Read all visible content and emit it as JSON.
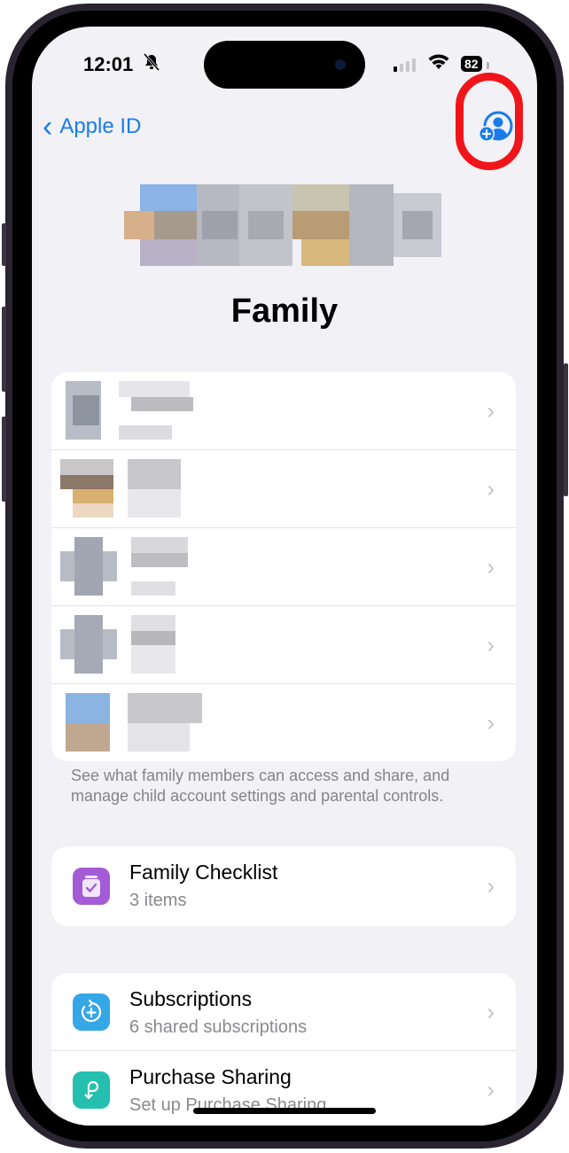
{
  "status_bar": {
    "time": "12:01",
    "silent_icon": "bell-slash-icon",
    "signal_icon": "cellular-signal-icon",
    "wifi_icon": "wifi-icon",
    "battery": "82"
  },
  "nav": {
    "back_label": "Apple ID",
    "back_icon": "chevron-left-icon",
    "add_member_icon": "person-add-icon",
    "accent_color": "#1a7ce8",
    "highlight_color": "#f0151a"
  },
  "header": {
    "title": "Family"
  },
  "members": {
    "count": 5,
    "items": [
      {
        "name": "[redacted]",
        "redacted": true
      },
      {
        "name": "[redacted]",
        "redacted": true
      },
      {
        "name": "[redacted]",
        "redacted": true
      },
      {
        "name": "[redacted]",
        "redacted": true
      },
      {
        "name": "[redacted]",
        "redacted": true
      }
    ],
    "footer": "See what family members can access and share, and manage child account settings and parental controls."
  },
  "checklist": {
    "title": "Family Checklist",
    "subtitle": "3 items",
    "icon": "checklist-icon",
    "icon_color": "#a45cd6"
  },
  "sharing": [
    {
      "title": "Subscriptions",
      "subtitle": "6 shared subscriptions",
      "icon": "subscriptions-icon",
      "icon_color": "#35a6e6"
    },
    {
      "title": "Purchase Sharing",
      "subtitle": "Set up Purchase Sharing",
      "icon": "purchase-sharing-icon",
      "icon_color": "#24bfae"
    }
  ]
}
